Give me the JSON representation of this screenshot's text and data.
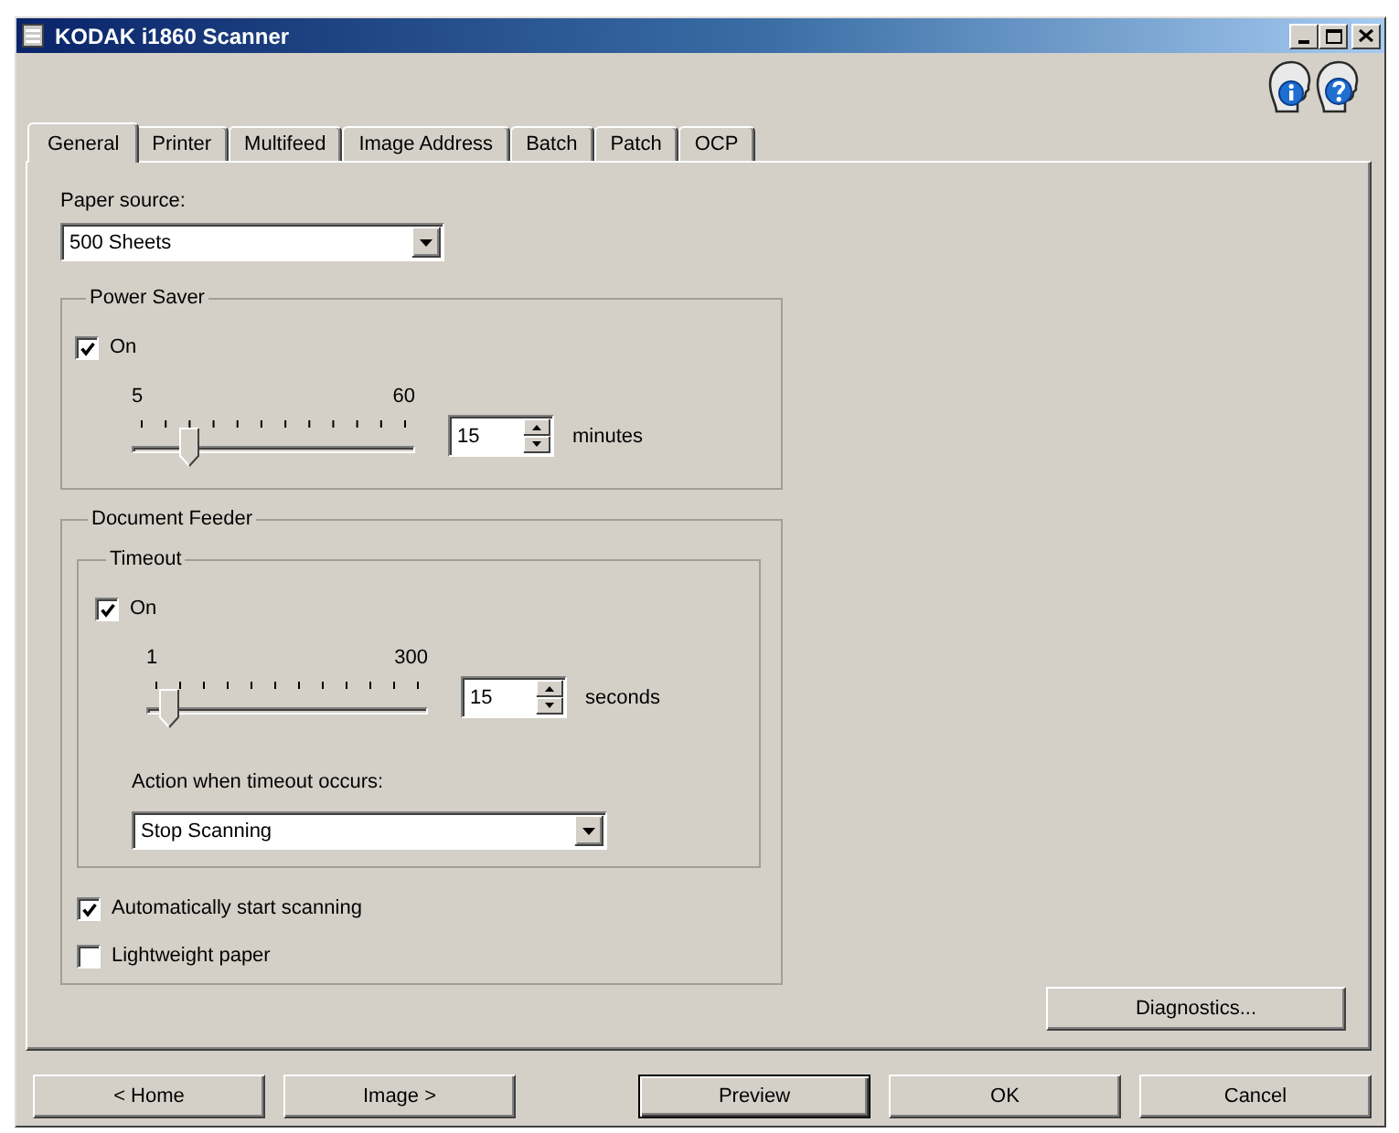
{
  "window": {
    "title": "KODAK i1860 Scanner"
  },
  "tabs": [
    {
      "label": "General",
      "selected": true
    },
    {
      "label": "Printer",
      "selected": false
    },
    {
      "label": "Multifeed",
      "selected": false
    },
    {
      "label": "Image Address",
      "selected": false
    },
    {
      "label": "Batch",
      "selected": false
    },
    {
      "label": "Patch",
      "selected": false
    },
    {
      "label": "OCP",
      "selected": false
    }
  ],
  "paper_source": {
    "label": "Paper source:",
    "value": "500 Sheets"
  },
  "power_saver": {
    "title": "Power Saver",
    "on": {
      "label": "On",
      "checked": true
    },
    "slider": {
      "min_label": "5",
      "max_label": "60",
      "level": 0.18
    },
    "spin_value": "15",
    "unit": "minutes"
  },
  "document_feeder": {
    "title": "Document Feeder",
    "timeout": {
      "title": "Timeout",
      "on": {
        "label": "On",
        "checked": true
      },
      "slider": {
        "min_label": "1",
        "max_label": "300",
        "level": 0.047
      },
      "spin_value": "15",
      "unit": "seconds",
      "action_label": "Action when timeout occurs:",
      "action_value": "Stop Scanning"
    },
    "options": [
      {
        "label": "Automatically start scanning",
        "checked": true
      },
      {
        "label": "Lightweight paper",
        "checked": false
      }
    ]
  },
  "diagnostics_button": {
    "label": "Diagnostics..."
  },
  "navigation_buttons": [
    {
      "label": "< Home",
      "default": false
    },
    {
      "label": "Image >",
      "default": false
    }
  ],
  "action_buttons": [
    {
      "label": "Preview",
      "default": true
    },
    {
      "label": "OK",
      "default": false
    },
    {
      "label": "Cancel",
      "default": false
    }
  ]
}
